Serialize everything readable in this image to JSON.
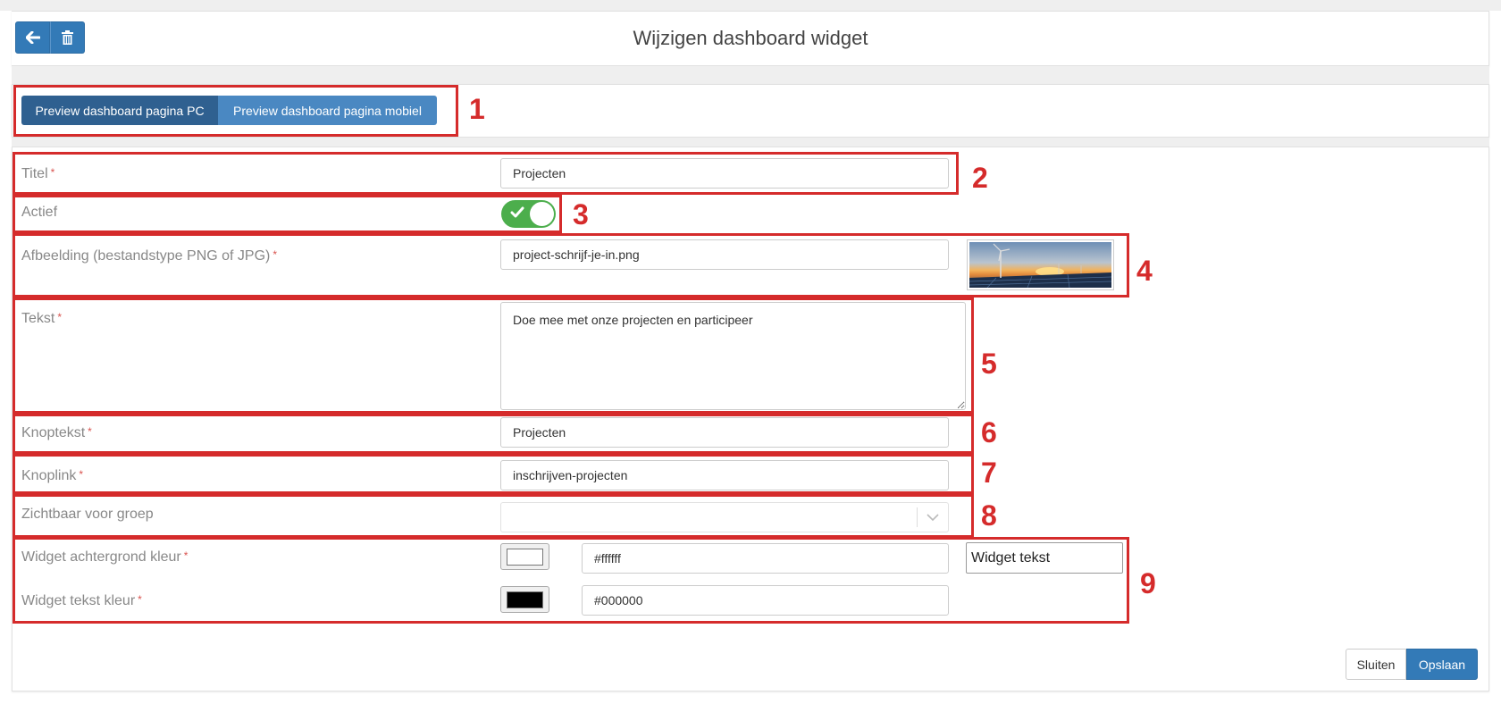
{
  "header": {
    "title": "Wijzigen dashboard widget",
    "back_icon": "arrow-left-icon",
    "delete_icon": "trash-icon"
  },
  "tabs": [
    {
      "label": "Preview dashboard pagina PC",
      "active": true
    },
    {
      "label": "Preview dashboard pagina mobiel",
      "active": false
    }
  ],
  "form": {
    "title": {
      "label": "Titel",
      "value": "Projecten"
    },
    "active": {
      "label": "Actief",
      "checked": true
    },
    "image": {
      "label": "Afbeelding (bestandstype PNG of JPG)",
      "value": "project-schrijf-je-in.png"
    },
    "text": {
      "label": "Tekst",
      "value": "Doe mee met onze projecten en participeer"
    },
    "button_text": {
      "label": "Knoptekst",
      "value": "Projecten"
    },
    "button_link": {
      "label": "Knoplink",
      "value": "inschrijven-projecten"
    },
    "visible_group": {
      "label": "Zichtbaar voor groep",
      "value": ""
    },
    "bg_color": {
      "label": "Widget achtergrond kleur",
      "value": "#ffffff",
      "swatch": "#ffffff"
    },
    "text_color": {
      "label": "Widget tekst kleur",
      "value": "#000000",
      "swatch": "#000000"
    },
    "preview_label": "Widget tekst",
    "required_mark": "*"
  },
  "annotations": [
    "1",
    "2",
    "3",
    "4",
    "5",
    "6",
    "7",
    "8",
    "9"
  ],
  "footer": {
    "close_label": "Sluiten",
    "save_label": "Opslaan"
  },
  "colors": {
    "primary": "#337ab7",
    "primary_dark": "#2f6090",
    "toggle_on": "#4cae4c",
    "annotation_red": "#d52b2b"
  }
}
